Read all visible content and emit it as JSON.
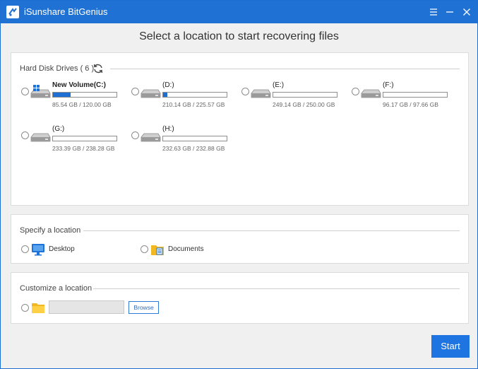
{
  "app": {
    "title": "iSunshare BitGenius",
    "accent_color": "#2071d4"
  },
  "heading": "Select a location to start recovering files",
  "hard_disk": {
    "title": "Hard Disk Drives ( 6 )",
    "refresh_icon": "refresh-icon",
    "drives": [
      {
        "name": "New Volume(C:)",
        "size": "85.54 GB / 120.00 GB",
        "used_fraction": 0.28,
        "system": true
      },
      {
        "name": "(D:)",
        "size": "210.14 GB / 225.57 GB",
        "used_fraction": 0.07,
        "system": false
      },
      {
        "name": "(E:)",
        "size": "249.14 GB / 250.00 GB",
        "used_fraction": 0.0,
        "system": false
      },
      {
        "name": "(F:)",
        "size": "96.17 GB / 97.66 GB",
        "used_fraction": 0.0,
        "system": false
      },
      {
        "name": "(G:)",
        "size": "233.39 GB / 238.28 GB",
        "used_fraction": 0.0,
        "system": false
      },
      {
        "name": "(H:)",
        "size": "232.63 GB / 232.88 GB",
        "used_fraction": 0.0,
        "system": false
      }
    ]
  },
  "specify": {
    "title": "Specify a location",
    "items": [
      {
        "label": "Desktop",
        "icon": "desktop-icon"
      },
      {
        "label": "Documents",
        "icon": "documents-icon"
      }
    ]
  },
  "customize": {
    "title": "Customize a location",
    "path_value": "",
    "browse_label": "Browse",
    "icon": "folder-icon"
  },
  "start_label": "Start"
}
